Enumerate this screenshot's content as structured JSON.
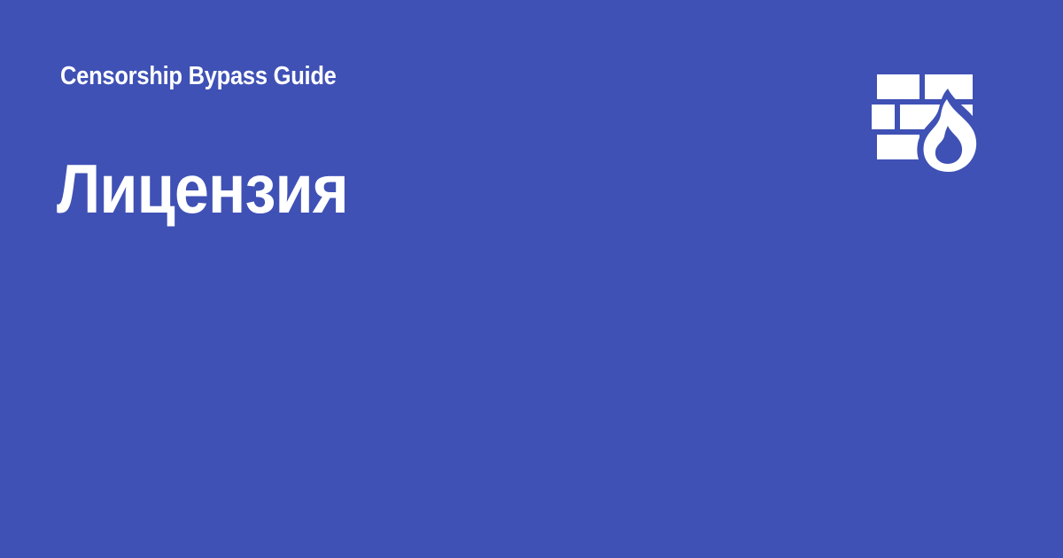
{
  "header": {
    "site_name": "Censorship Bypass Guide"
  },
  "page": {
    "title": "Лицензия"
  },
  "logo": {
    "icon": "firewall-icon"
  },
  "colors": {
    "background": "#3f51b5",
    "text": "#ffffff",
    "icon": "#ffffff"
  }
}
